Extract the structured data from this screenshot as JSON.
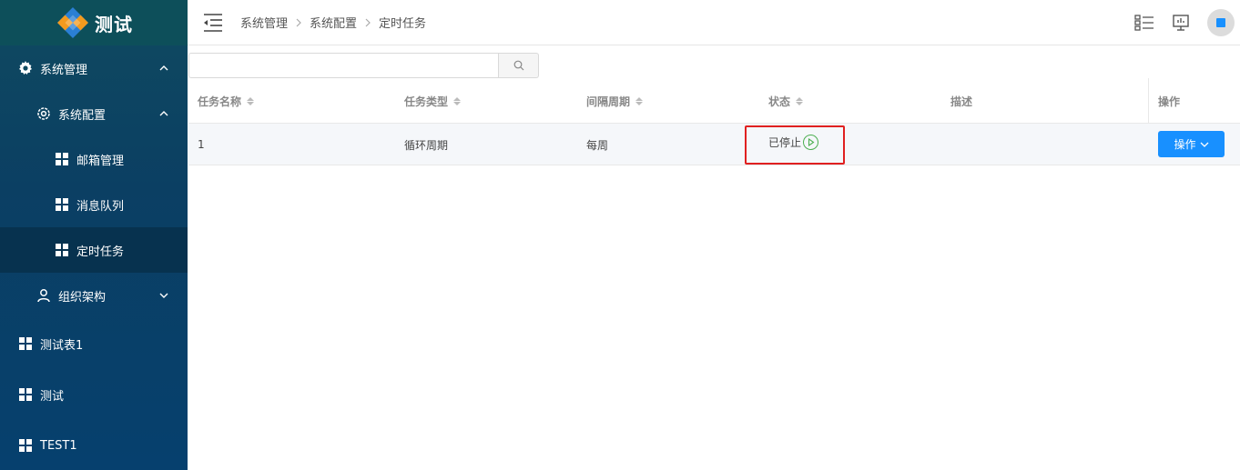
{
  "app": {
    "logo_text": "测试"
  },
  "sidebar": {
    "items": [
      {
        "label": "系统管理"
      },
      {
        "label": "系统配置"
      },
      {
        "label": "邮箱管理"
      },
      {
        "label": "消息队列"
      },
      {
        "label": "定时任务"
      },
      {
        "label": "组织架构"
      },
      {
        "label": "测试表1"
      },
      {
        "label": "测试"
      },
      {
        "label": "TEST1"
      }
    ]
  },
  "breadcrumb": {
    "items": [
      "系统管理",
      "系统配置",
      "定时任务"
    ]
  },
  "search": {
    "placeholder": "",
    "value": ""
  },
  "table": {
    "columns": [
      "任务名称",
      "任务类型",
      "间隔周期",
      "状态",
      "描述",
      "操作"
    ],
    "rows": [
      {
        "name": "1",
        "type": "循环周期",
        "interval": "每周",
        "status": "已停止",
        "description": "",
        "action": "操作"
      }
    ]
  },
  "colors": {
    "accent": "#1890ff",
    "sidebar": "#0b3f63",
    "highlight_border": "#e02020",
    "status_icon": "#4caf50"
  }
}
